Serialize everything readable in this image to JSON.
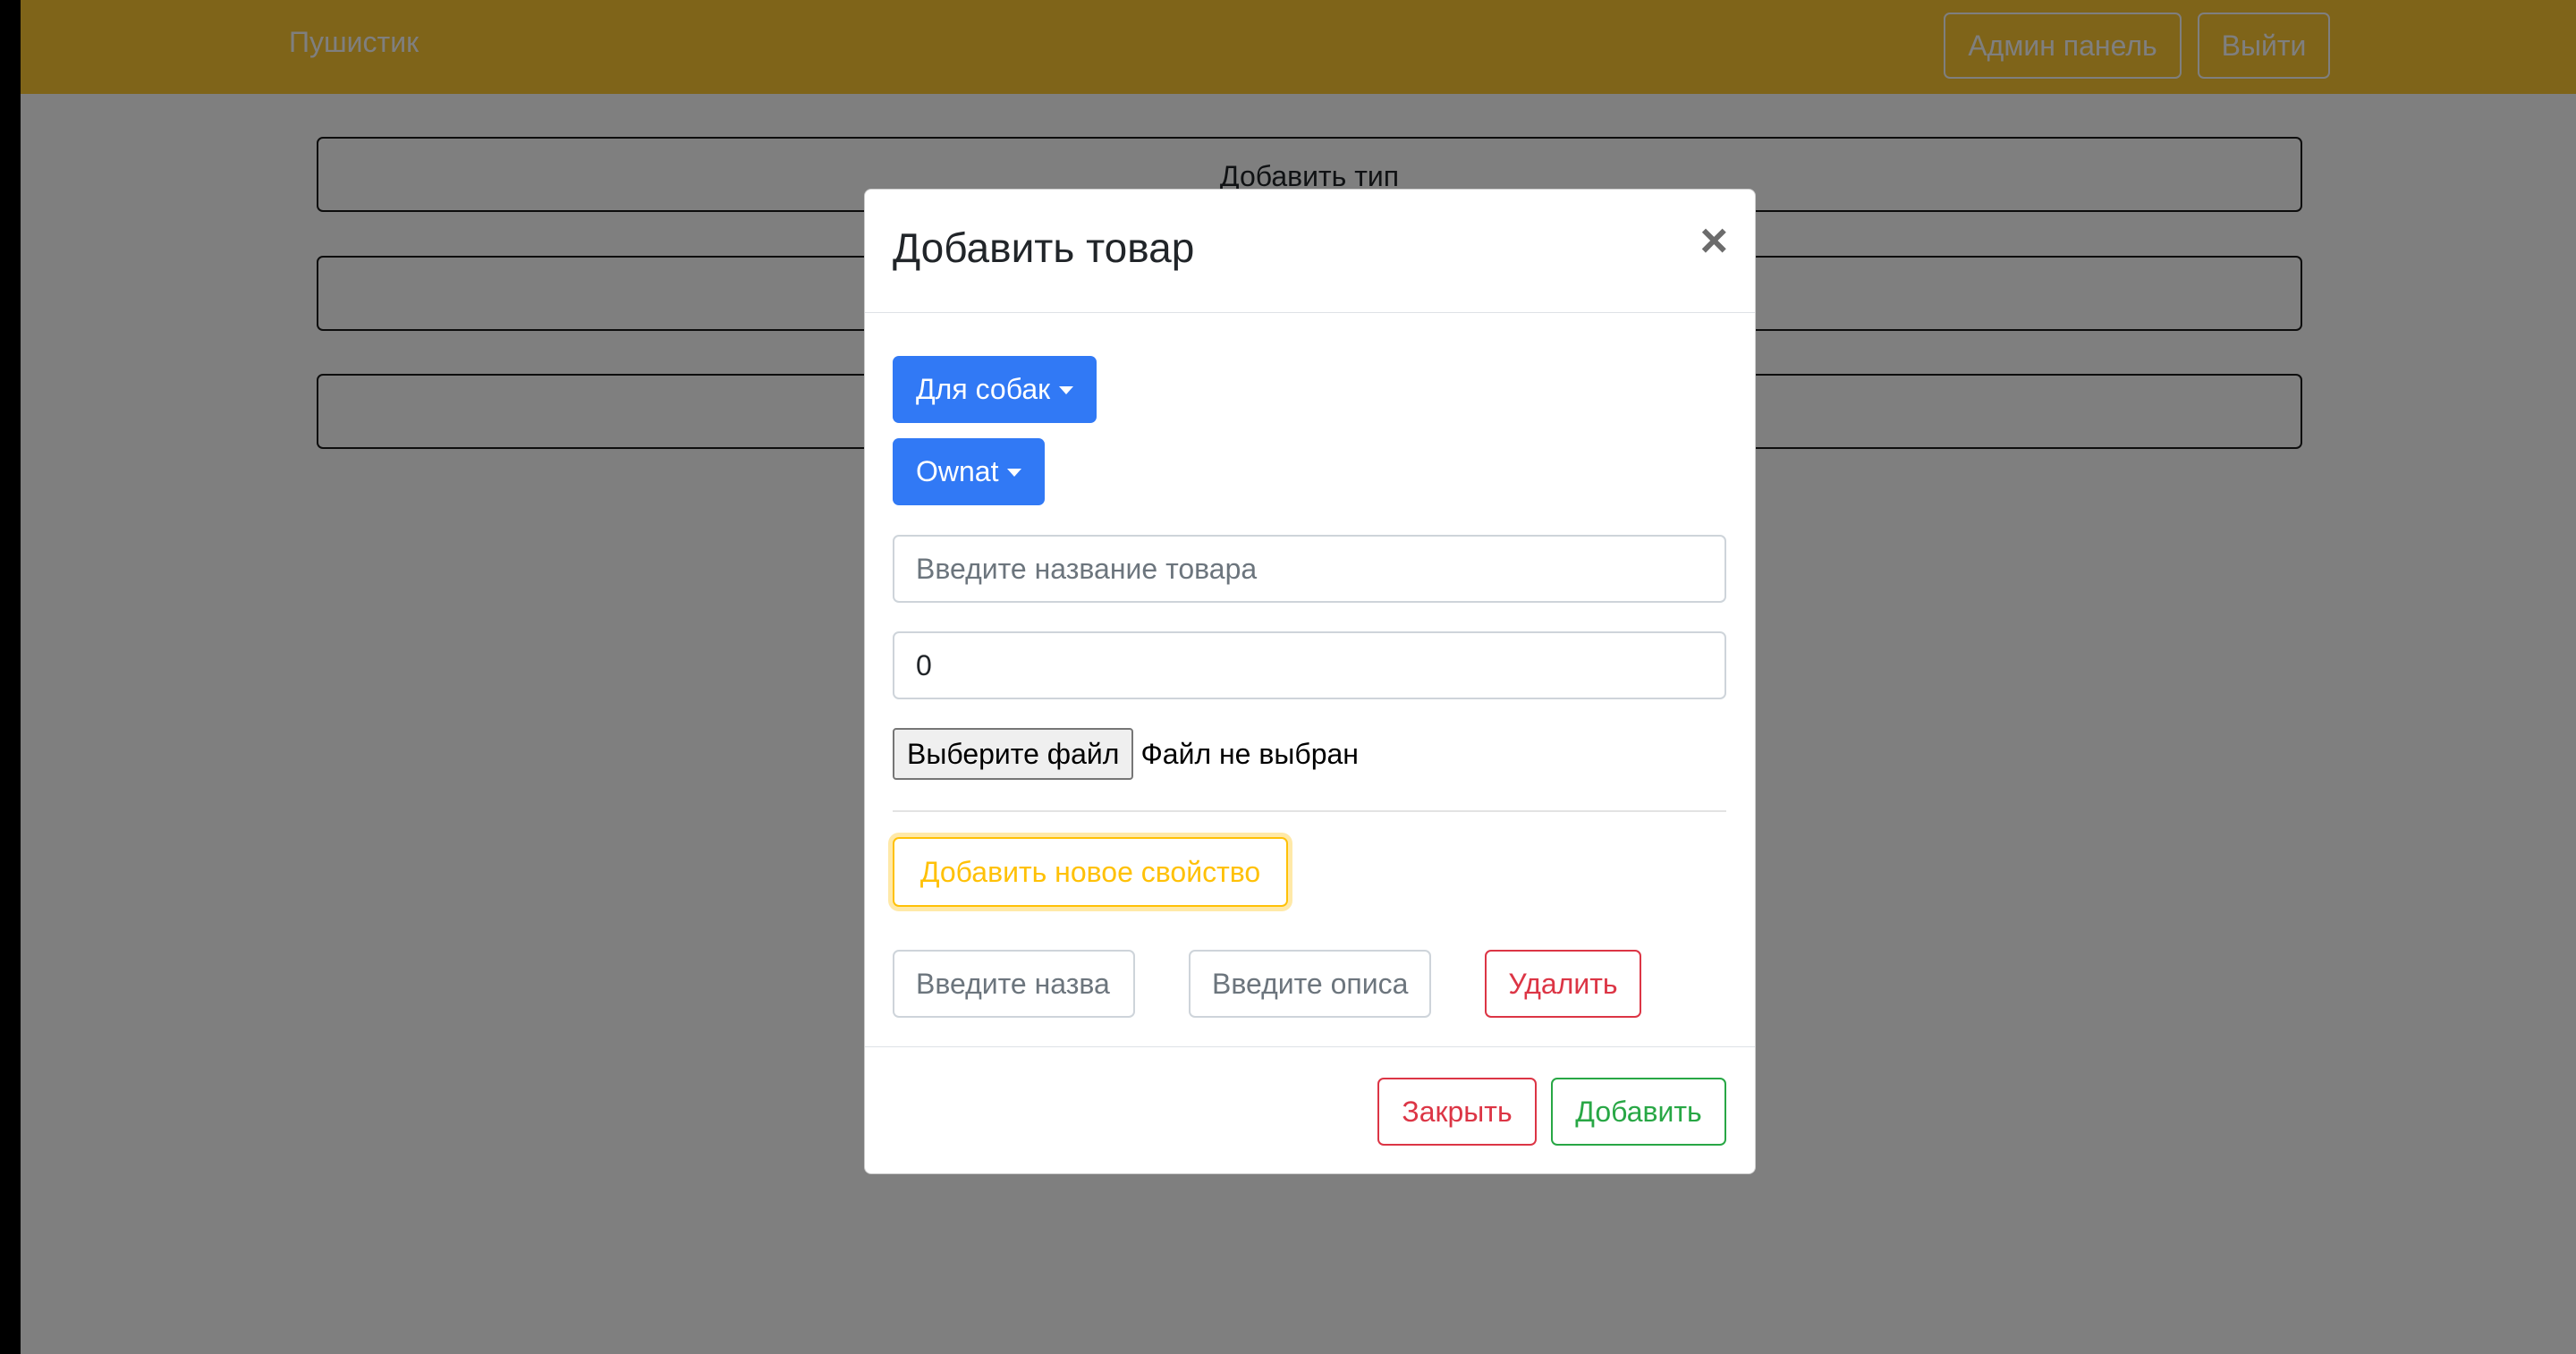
{
  "navbar": {
    "brand": "Пушистик",
    "admin_label": "Админ панель",
    "logout_label": "Выйти"
  },
  "main": {
    "buttons": [
      {
        "label": "Добавить тип"
      },
      {
        "label": ""
      },
      {
        "label": ""
      }
    ]
  },
  "modal": {
    "title": "Добавить товар",
    "close_glyph": "×",
    "type_dropdown": "Для собак",
    "brand_dropdown": "Ownat",
    "name_placeholder": "Введите название товара",
    "price_value": "0",
    "file_button": "Выберите файл",
    "file_status": "Файл не выбран",
    "add_property_label": "Добавить новое свойство",
    "property": {
      "name_placeholder": "Введите назва",
      "description_placeholder": "Введите описа",
      "delete_label": "Удалить"
    },
    "footer": {
      "close_label": "Закрыть",
      "add_label": "Добавить"
    }
  },
  "colors": {
    "navbar": "#ffc832",
    "primary": "#3179f5",
    "warning": "#ffc107",
    "danger": "#dc3545",
    "success": "#28a745"
  }
}
